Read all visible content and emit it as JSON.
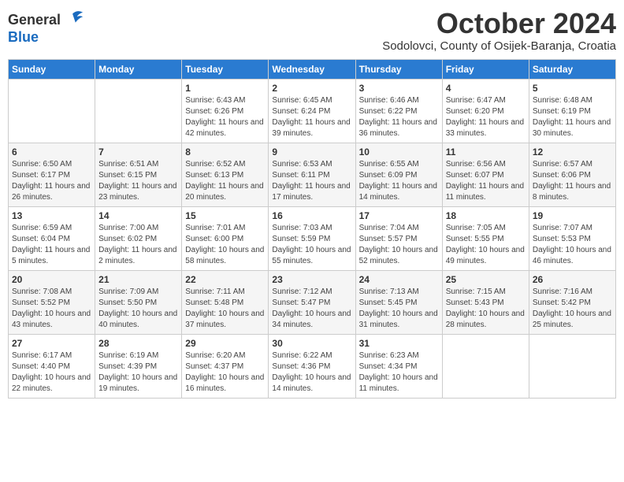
{
  "header": {
    "logo_general": "General",
    "logo_blue": "Blue",
    "month": "October 2024",
    "location": "Sodolovci, County of Osijek-Baranja, Croatia"
  },
  "calendar": {
    "weekdays": [
      "Sunday",
      "Monday",
      "Tuesday",
      "Wednesday",
      "Thursday",
      "Friday",
      "Saturday"
    ],
    "weeks": [
      [
        {
          "day": "",
          "detail": ""
        },
        {
          "day": "",
          "detail": ""
        },
        {
          "day": "1",
          "detail": "Sunrise: 6:43 AM\nSunset: 6:26 PM\nDaylight: 11 hours and 42 minutes."
        },
        {
          "day": "2",
          "detail": "Sunrise: 6:45 AM\nSunset: 6:24 PM\nDaylight: 11 hours and 39 minutes."
        },
        {
          "day": "3",
          "detail": "Sunrise: 6:46 AM\nSunset: 6:22 PM\nDaylight: 11 hours and 36 minutes."
        },
        {
          "day": "4",
          "detail": "Sunrise: 6:47 AM\nSunset: 6:20 PM\nDaylight: 11 hours and 33 minutes."
        },
        {
          "day": "5",
          "detail": "Sunrise: 6:48 AM\nSunset: 6:19 PM\nDaylight: 11 hours and 30 minutes."
        }
      ],
      [
        {
          "day": "6",
          "detail": "Sunrise: 6:50 AM\nSunset: 6:17 PM\nDaylight: 11 hours and 26 minutes."
        },
        {
          "day": "7",
          "detail": "Sunrise: 6:51 AM\nSunset: 6:15 PM\nDaylight: 11 hours and 23 minutes."
        },
        {
          "day": "8",
          "detail": "Sunrise: 6:52 AM\nSunset: 6:13 PM\nDaylight: 11 hours and 20 minutes."
        },
        {
          "day": "9",
          "detail": "Sunrise: 6:53 AM\nSunset: 6:11 PM\nDaylight: 11 hours and 17 minutes."
        },
        {
          "day": "10",
          "detail": "Sunrise: 6:55 AM\nSunset: 6:09 PM\nDaylight: 11 hours and 14 minutes."
        },
        {
          "day": "11",
          "detail": "Sunrise: 6:56 AM\nSunset: 6:07 PM\nDaylight: 11 hours and 11 minutes."
        },
        {
          "day": "12",
          "detail": "Sunrise: 6:57 AM\nSunset: 6:06 PM\nDaylight: 11 hours and 8 minutes."
        }
      ],
      [
        {
          "day": "13",
          "detail": "Sunrise: 6:59 AM\nSunset: 6:04 PM\nDaylight: 11 hours and 5 minutes."
        },
        {
          "day": "14",
          "detail": "Sunrise: 7:00 AM\nSunset: 6:02 PM\nDaylight: 11 hours and 2 minutes."
        },
        {
          "day": "15",
          "detail": "Sunrise: 7:01 AM\nSunset: 6:00 PM\nDaylight: 10 hours and 58 minutes."
        },
        {
          "day": "16",
          "detail": "Sunrise: 7:03 AM\nSunset: 5:59 PM\nDaylight: 10 hours and 55 minutes."
        },
        {
          "day": "17",
          "detail": "Sunrise: 7:04 AM\nSunset: 5:57 PM\nDaylight: 10 hours and 52 minutes."
        },
        {
          "day": "18",
          "detail": "Sunrise: 7:05 AM\nSunset: 5:55 PM\nDaylight: 10 hours and 49 minutes."
        },
        {
          "day": "19",
          "detail": "Sunrise: 7:07 AM\nSunset: 5:53 PM\nDaylight: 10 hours and 46 minutes."
        }
      ],
      [
        {
          "day": "20",
          "detail": "Sunrise: 7:08 AM\nSunset: 5:52 PM\nDaylight: 10 hours and 43 minutes."
        },
        {
          "day": "21",
          "detail": "Sunrise: 7:09 AM\nSunset: 5:50 PM\nDaylight: 10 hours and 40 minutes."
        },
        {
          "day": "22",
          "detail": "Sunrise: 7:11 AM\nSunset: 5:48 PM\nDaylight: 10 hours and 37 minutes."
        },
        {
          "day": "23",
          "detail": "Sunrise: 7:12 AM\nSunset: 5:47 PM\nDaylight: 10 hours and 34 minutes."
        },
        {
          "day": "24",
          "detail": "Sunrise: 7:13 AM\nSunset: 5:45 PM\nDaylight: 10 hours and 31 minutes."
        },
        {
          "day": "25",
          "detail": "Sunrise: 7:15 AM\nSunset: 5:43 PM\nDaylight: 10 hours and 28 minutes."
        },
        {
          "day": "26",
          "detail": "Sunrise: 7:16 AM\nSunset: 5:42 PM\nDaylight: 10 hours and 25 minutes."
        }
      ],
      [
        {
          "day": "27",
          "detail": "Sunrise: 6:17 AM\nSunset: 4:40 PM\nDaylight: 10 hours and 22 minutes."
        },
        {
          "day": "28",
          "detail": "Sunrise: 6:19 AM\nSunset: 4:39 PM\nDaylight: 10 hours and 19 minutes."
        },
        {
          "day": "29",
          "detail": "Sunrise: 6:20 AM\nSunset: 4:37 PM\nDaylight: 10 hours and 16 minutes."
        },
        {
          "day": "30",
          "detail": "Sunrise: 6:22 AM\nSunset: 4:36 PM\nDaylight: 10 hours and 14 minutes."
        },
        {
          "day": "31",
          "detail": "Sunrise: 6:23 AM\nSunset: 4:34 PM\nDaylight: 10 hours and 11 minutes."
        },
        {
          "day": "",
          "detail": ""
        },
        {
          "day": "",
          "detail": ""
        }
      ]
    ]
  }
}
